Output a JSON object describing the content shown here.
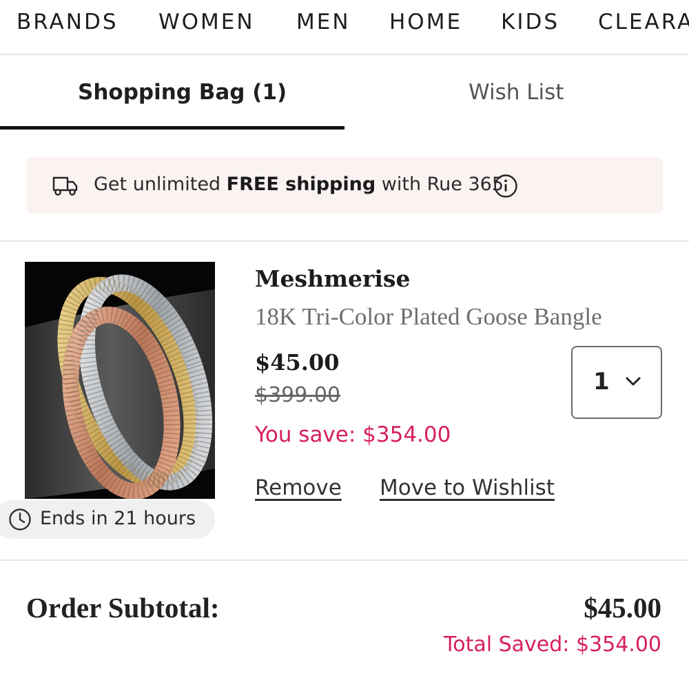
{
  "nav": {
    "items": [
      "BRANDS",
      "WOMEN",
      "MEN",
      "HOME",
      "KIDS",
      "CLEARA"
    ]
  },
  "tabs": {
    "shopping_bag": "Shopping Bag (1)",
    "wish_list": "Wish List"
  },
  "promo": {
    "prefix": "Get unlimited ",
    "bold": "FREE shipping",
    "suffix": " with Rue 365",
    "truck_icon": "truck-icon",
    "info_icon": "info-icon"
  },
  "item": {
    "brand": "Meshmerise",
    "name": "18K Tri-Color Plated Goose Bangle",
    "price": "$45.00",
    "original_price": "$399.00",
    "you_save": "You save: $354.00",
    "quantity": "1",
    "remove_label": "Remove",
    "move_label": "Move to Wishlist",
    "ends_in": "Ends in 21 hours",
    "image_alt": "tri-color bangle bracelets"
  },
  "summary": {
    "subtotal_label": "Order Subtotal:",
    "subtotal_value": "$45.00",
    "total_saved": "Total Saved: $354.00"
  },
  "colors": {
    "accent_pink": "#d6205c",
    "promo_bg": "#faf3f2"
  }
}
